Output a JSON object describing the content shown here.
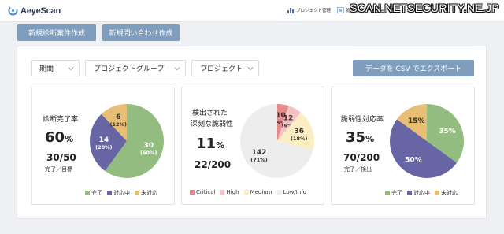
{
  "header": {
    "logo_text": "AeyeScan",
    "nav": [
      {
        "label": "プロジェクト管理",
        "icon": "bar-chart-icon"
      },
      {
        "label": "脆弱性管理",
        "icon": "list-icon"
      },
      {
        "label": "",
        "icon": "user-icon"
      },
      {
        "label": "",
        "icon": "user-icon"
      }
    ],
    "watermark": "SCAN.NETSECURITY.NE.JP"
  },
  "actions": {
    "new_diagnosis": "新規診断案件作成",
    "new_inquiry": "新規問い合わせ作成"
  },
  "filters": {
    "period": "期間",
    "project_group": "プロジェクトグループ",
    "project": "プロジェクト",
    "export_label": "データを CSV でエクスポート"
  },
  "colors": {
    "done": "#93bd80",
    "in_progress": "#6865a4",
    "not_handled": "#e8be75",
    "critical": "#e88a8a",
    "high": "#f5c1c3",
    "medium": "#fbeec3",
    "low_info": "#ededed",
    "button": "#7f9dbd"
  },
  "cards": [
    {
      "title": "診断完了率",
      "big_value": "60",
      "big_unit": "%",
      "ratio": "30/50",
      "sub": "完了／目標",
      "chart_data": {
        "type": "pie",
        "slices": [
          {
            "key": "done",
            "value": 30,
            "label": "30",
            "pct": "(60%)"
          },
          {
            "key": "in_progress",
            "value": 14,
            "label": "14",
            "pct": "(28%)"
          },
          {
            "key": "not_handled",
            "value": 6,
            "label": "6",
            "pct": "(12%)"
          }
        ]
      },
      "legend": [
        {
          "key": "done",
          "label": "完了"
        },
        {
          "key": "in_progress",
          "label": "対応中"
        },
        {
          "key": "not_handled",
          "label": "未対応"
        }
      ]
    },
    {
      "title": "検出された",
      "title2": "深刻な脆弱性",
      "big_value": "11",
      "big_unit": "%",
      "ratio": "22/200",
      "chart_data": {
        "type": "pie",
        "slices": [
          {
            "key": "critical",
            "value": 10,
            "label": "10",
            "pct": "(5%)"
          },
          {
            "key": "high",
            "value": 12,
            "label": "12",
            "pct": "(6%)"
          },
          {
            "key": "medium",
            "value": 36,
            "label": "36",
            "pct": "(18%)"
          },
          {
            "key": "low_info",
            "value": 142,
            "label": "142",
            "pct": "(71%)"
          }
        ]
      },
      "legend": [
        {
          "key": "critical",
          "label": "Critical"
        },
        {
          "key": "high",
          "label": "High"
        },
        {
          "key": "medium",
          "label": "Medium"
        },
        {
          "key": "low_info",
          "label": "Low/Info"
        }
      ]
    },
    {
      "title": "脆弱性対応率",
      "big_value": "35",
      "big_unit": "%",
      "ratio": "70/200",
      "sub": "完了／検出",
      "chart_data": {
        "type": "pie",
        "slices": [
          {
            "key": "done",
            "value": 35,
            "label": "35%"
          },
          {
            "key": "in_progress",
            "value": 50,
            "label": "50%"
          },
          {
            "key": "not_handled",
            "value": 15,
            "label": "15%"
          }
        ]
      },
      "legend": [
        {
          "key": "done",
          "label": "完了"
        },
        {
          "key": "in_progress",
          "label": "対応中"
        },
        {
          "key": "not_handled",
          "label": "未対応"
        }
      ]
    }
  ]
}
